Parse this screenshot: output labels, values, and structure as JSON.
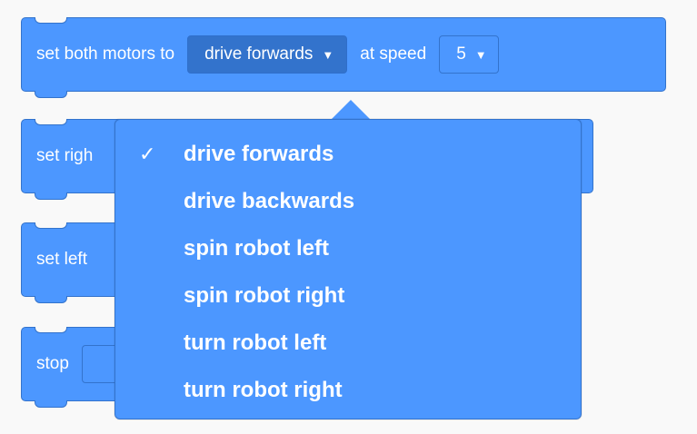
{
  "blocks": {
    "set_both": {
      "prefix": "set both motors to",
      "direction_value": "drive forwards",
      "speed_label": "at speed",
      "speed_value": "5"
    },
    "set_right": {
      "prefix": "set righ"
    },
    "set_left": {
      "prefix": "set left"
    },
    "stop": {
      "prefix": "stop"
    }
  },
  "menu": {
    "selected_mark": "✓",
    "caret": "▼",
    "options": [
      "drive forwards",
      "drive backwards",
      "spin robot left",
      "spin robot right",
      "turn robot left",
      "turn robot right"
    ]
  },
  "colors": {
    "block": "#4c97ff",
    "block_border": "#3373cc",
    "dropdown_open": "#3373cc",
    "background": "#f9f9f9"
  }
}
